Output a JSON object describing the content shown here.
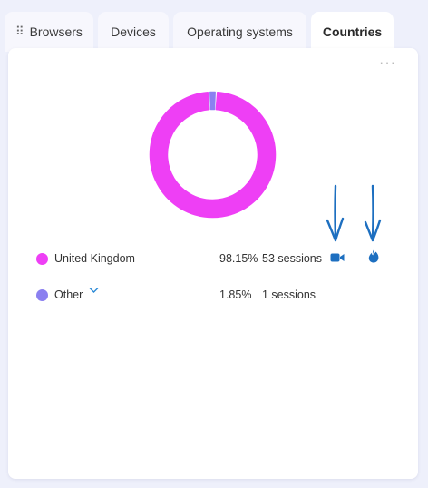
{
  "tabs": [
    {
      "label": "Browsers",
      "active": false
    },
    {
      "label": "Devices",
      "active": false
    },
    {
      "label": "Operating systems",
      "active": false
    },
    {
      "label": "Countries",
      "active": true
    }
  ],
  "panel": {
    "more_label": "···"
  },
  "chart_data": {
    "type": "pie",
    "variant": "donut",
    "categories": [
      "United Kingdom",
      "Other"
    ],
    "values": [
      98.15,
      1.85
    ],
    "colors": [
      "#ee3ff5",
      "#8b80f0"
    ],
    "sessions": [
      53,
      1
    ]
  },
  "legend": [
    {
      "name": "United Kingdom",
      "percent": "98.15%",
      "sessions": "53 sessions",
      "color": "#ee3ff5"
    },
    {
      "name": "Other",
      "percent": "1.85%",
      "sessions": "1 sessions",
      "color": "#8b80f0",
      "expandable": true
    }
  ],
  "annotations": {
    "arrow_color": "#1d6fc0",
    "icons": [
      "video-camera-icon",
      "flame-icon"
    ]
  }
}
